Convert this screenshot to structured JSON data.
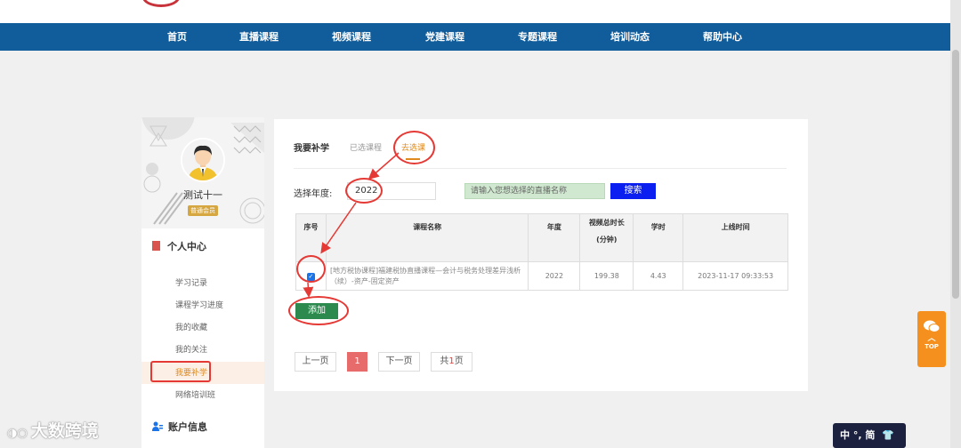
{
  "nav": {
    "items": [
      "首页",
      "直播课程",
      "视频课程",
      "党建课程",
      "专题课程",
      "培训动态",
      "帮助中心"
    ]
  },
  "sidebar": {
    "username": "测试十一",
    "badge": "普通会员",
    "personal_center": "个人中心",
    "links": [
      "学习记录",
      "课程学习进度",
      "我的收藏",
      "我的关注",
      "我要补学",
      "网络培训班"
    ],
    "account_info": "账户信息"
  },
  "main": {
    "tabs": [
      "我要补学",
      "已选课程",
      "去选课"
    ],
    "year_label": "选择年度:",
    "year_value": "2022",
    "search_placeholder": "请输入您想选择的直播名称",
    "search_button": "搜索",
    "table": {
      "headers": [
        "序号",
        "课程名称",
        "年度",
        "视频总时长",
        "(分钟)",
        "学时",
        "上线时间"
      ],
      "rows": [
        {
          "name_line1": "[地方税协课程]福建税协直播课程—会计与税务处理差异浅析",
          "name_line2": "（续）-资产-固定资产",
          "year": "2022",
          "duration": "199.38",
          "hours": "4.43",
          "online_time": "2023-11-17 09:33:53"
        }
      ]
    },
    "add_button": "添加",
    "pager": {
      "prev": "上一页",
      "current": "1",
      "next": "下一页",
      "total_prefix": "共",
      "total": "1",
      "total_suffix": "页"
    }
  },
  "widgets": {
    "top_label": "TOP",
    "ime_text": "中 °, 简",
    "watermark": "大数跨境"
  },
  "colors": {
    "nav": "#115d9b",
    "accent": "#e53935",
    "add": "#2d8a4e",
    "search": "#0b1ff0",
    "top": "#f5901e"
  }
}
